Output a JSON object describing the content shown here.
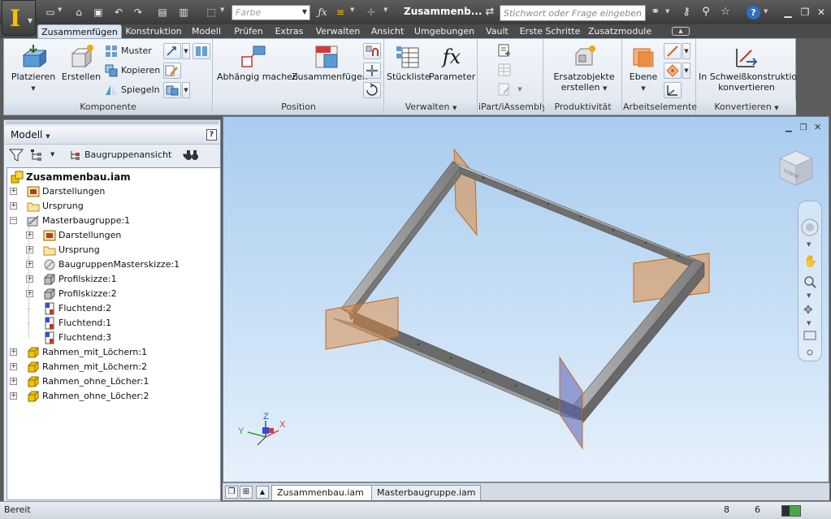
{
  "titlebar": {
    "color_field": "Farbe",
    "document_title": "Zusammenb...",
    "search_placeholder": "Stichwort oder Frage eingeben",
    "help_label": "?"
  },
  "ribbon_tabs": [
    "Zusammenfügen",
    "Konstruktion",
    "Modell",
    "Prüfen",
    "Extras",
    "Verwalten",
    "Ansicht",
    "Umgebungen",
    "Vault",
    "Erste Schritte",
    "Zusatzmodule"
  ],
  "ribbon": {
    "komponente": {
      "label": "Komponente",
      "platzieren": "Platzieren",
      "erstellen": "Erstellen",
      "muster": "Muster",
      "kopieren": "Kopieren",
      "spiegeln": "Spiegeln"
    },
    "position": {
      "label": "Position",
      "abhaengig": "Abhängig machen",
      "zusammenfuegen": "Zusammenfügen"
    },
    "verwalten": {
      "label": "Verwalten",
      "stueckliste": "Stückliste",
      "parameter": "Parameter",
      "fx": "fx"
    },
    "ipart": {
      "label": "iPart/iAssembly"
    },
    "produktivitaet": {
      "label": "Produktivität",
      "ersatz_line1": "Ersatzobjekte",
      "ersatz_line2": "erstellen"
    },
    "arbeitselemente": {
      "label": "Arbeitselemente",
      "ebene": "Ebene"
    },
    "konvertieren": {
      "label": "Konvertieren",
      "line1": "In Schweißkonstruktion",
      "line2": "konvertieren"
    }
  },
  "browser": {
    "title": "Modell",
    "view_select": "Baugruppenansicht",
    "help": "?",
    "tree": [
      {
        "label": "Zusammenbau.iam",
        "level": 0,
        "icon": "assembly-icon",
        "expander": "",
        "root": true
      },
      {
        "label": "Darstellungen",
        "level": 1,
        "icon": "representations-icon",
        "expander": "+"
      },
      {
        "label": "Ursprung",
        "level": 1,
        "icon": "folder-icon",
        "expander": "+"
      },
      {
        "label": "Masterbaugruppe:1",
        "level": 1,
        "icon": "master-assembly-icon",
        "expander": "−"
      },
      {
        "label": "Darstellungen",
        "level": 2,
        "icon": "representations-icon",
        "expander": "+"
      },
      {
        "label": "Ursprung",
        "level": 2,
        "icon": "folder-icon",
        "expander": "+"
      },
      {
        "label": "BaugruppenMasterskizze:1",
        "level": 2,
        "icon": "sketch-part-icon",
        "expander": "+"
      },
      {
        "label": "Profilskizze:1",
        "level": 2,
        "icon": "gray-part-icon",
        "expander": "+"
      },
      {
        "label": "Profilskizze:2",
        "level": 2,
        "icon": "gray-part-icon",
        "expander": "+"
      },
      {
        "label": "Fluchtend:2",
        "level": 2,
        "icon": "flush-constraint-icon",
        "expander": ""
      },
      {
        "label": "Fluchtend:1",
        "level": 2,
        "icon": "flush-constraint-icon",
        "expander": ""
      },
      {
        "label": "Fluchtend:3",
        "level": 2,
        "icon": "flush-constraint-icon",
        "expander": ""
      },
      {
        "label": "Rahmen_mit_Löchern:1",
        "level": 1,
        "icon": "yellow-part-icon",
        "expander": "+"
      },
      {
        "label": "Rahmen_mit_Löchern:2",
        "level": 1,
        "icon": "yellow-part-icon",
        "expander": "+"
      },
      {
        "label": "Rahmen_ohne_Löcher:1",
        "level": 1,
        "icon": "yellow-part-icon",
        "expander": "+"
      },
      {
        "label": "Rahmen_ohne_Löcher:2",
        "level": 1,
        "icon": "yellow-part-icon",
        "expander": "+"
      }
    ]
  },
  "doc_tabs": [
    {
      "label": "Zusammenbau.iam",
      "active": true,
      "close": "⊠"
    },
    {
      "label": "Masterbaugruppe.iam",
      "active": false,
      "close": ""
    }
  ],
  "viewcube": {
    "label": "VORNE"
  },
  "triad": {
    "x": "X",
    "y": "Y",
    "z": "Z"
  },
  "status": {
    "text": "Bereit",
    "count1": "8",
    "count2": "6"
  },
  "colors": {
    "accent_yellow": "#f2c200",
    "frame_steel": "#a9a9a9",
    "plane_orange": "#e08a3c",
    "viewport_top": "#a9ccef",
    "viewport_bottom": "#e6f1fb"
  }
}
